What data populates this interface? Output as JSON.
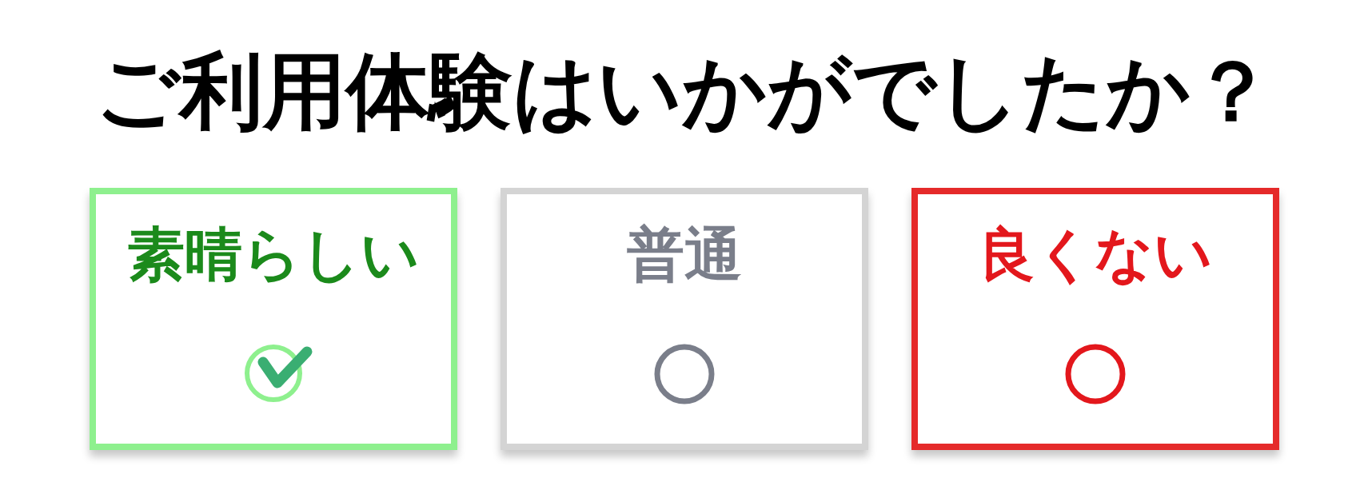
{
  "title": "ご利用体験はいかがでしたか？",
  "options": [
    {
      "label": "素晴らしい",
      "selected": true,
      "color": "#1b8a1b",
      "border": {
        "color": "#8ef08e"
      }
    },
    {
      "label": "普通",
      "selected": false,
      "color": "#7a7e8a",
      "border": {
        "color": "#d4d4d4"
      }
    },
    {
      "label": "良くない",
      "selected": false,
      "color": "#e3171c",
      "border": {
        "color": "#e52a2a"
      }
    }
  ]
}
